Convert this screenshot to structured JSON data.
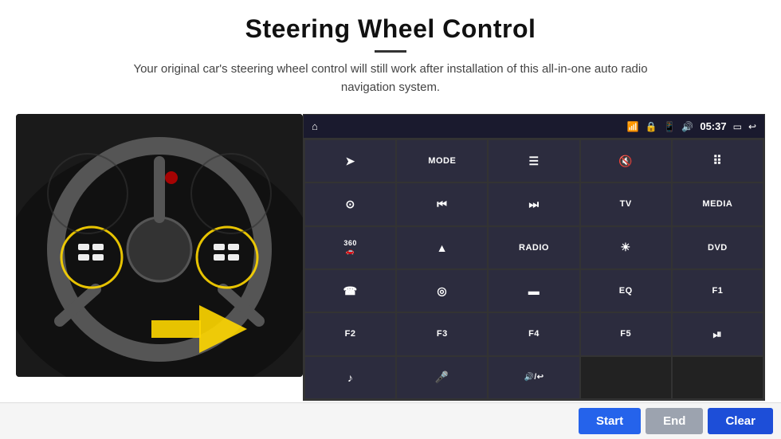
{
  "header": {
    "title": "Steering Wheel Control",
    "subtitle": "Your original car's steering wheel control will still work after installation of this all-in-one auto radio navigation system."
  },
  "status_bar": {
    "time": "05:37",
    "icons": [
      "wifi",
      "lock",
      "sim",
      "bluetooth",
      "screen",
      "back"
    ]
  },
  "grid": {
    "rows": [
      [
        {
          "label": "⌂",
          "type": "icon"
        },
        {
          "label": "➤",
          "type": "icon"
        },
        {
          "label": "MODE",
          "type": "text"
        },
        {
          "label": "☰",
          "type": "icon"
        },
        {
          "label": "🔇",
          "type": "icon"
        },
        {
          "label": "⠿",
          "type": "icon"
        }
      ],
      [
        {
          "label": "⊙",
          "type": "icon"
        },
        {
          "label": "⏮",
          "type": "icon"
        },
        {
          "label": "⏭",
          "type": "icon"
        },
        {
          "label": "TV",
          "type": "text"
        },
        {
          "label": "MEDIA",
          "type": "text"
        }
      ],
      [
        {
          "label": "360",
          "type": "text-small"
        },
        {
          "label": "▲",
          "type": "icon"
        },
        {
          "label": "RADIO",
          "type": "text"
        },
        {
          "label": "☀",
          "type": "icon"
        },
        {
          "label": "DVD",
          "type": "text"
        }
      ],
      [
        {
          "label": "☎",
          "type": "icon"
        },
        {
          "label": "◎",
          "type": "icon"
        },
        {
          "label": "▬",
          "type": "icon"
        },
        {
          "label": "EQ",
          "type": "text"
        },
        {
          "label": "F1",
          "type": "text"
        }
      ],
      [
        {
          "label": "F2",
          "type": "text"
        },
        {
          "label": "F3",
          "type": "text"
        },
        {
          "label": "F4",
          "type": "text"
        },
        {
          "label": "F5",
          "type": "text"
        },
        {
          "label": "⏯",
          "type": "icon"
        }
      ],
      [
        {
          "label": "♪",
          "type": "icon"
        },
        {
          "label": "🎤",
          "type": "icon"
        },
        {
          "label": "🔊/↩",
          "type": "icon"
        },
        {
          "label": "",
          "type": "empty"
        },
        {
          "label": "",
          "type": "empty"
        }
      ]
    ],
    "buttons": {
      "start": "Start",
      "end": "End",
      "clear": "Clear"
    }
  }
}
